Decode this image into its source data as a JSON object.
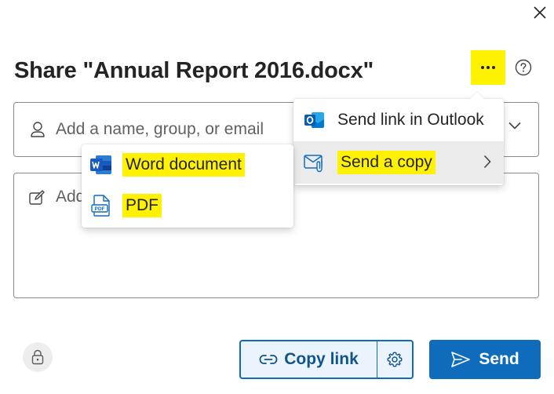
{
  "dialog": {
    "title": "Share \"Annual Report 2016.docx\""
  },
  "recipients": {
    "placeholder": "Add a name, group, or email"
  },
  "message": {
    "placeholder": "Add"
  },
  "more_menu": {
    "items": [
      {
        "label": "Send link in Outlook",
        "icon": "outlook-icon"
      },
      {
        "label": "Send a copy",
        "icon": "mail-attachment-icon",
        "has_submenu": true,
        "selected": true
      }
    ]
  },
  "send_copy_submenu": {
    "items": [
      {
        "label": "Word document",
        "icon": "word-icon"
      },
      {
        "label": "PDF",
        "icon": "pdf-icon"
      }
    ]
  },
  "footer": {
    "copy_link_label": "Copy link",
    "send_label": "Send"
  },
  "colors": {
    "accent": "#0f6cbd",
    "highlight": "#fff200",
    "selected_item_bg": "#ebebeb"
  }
}
